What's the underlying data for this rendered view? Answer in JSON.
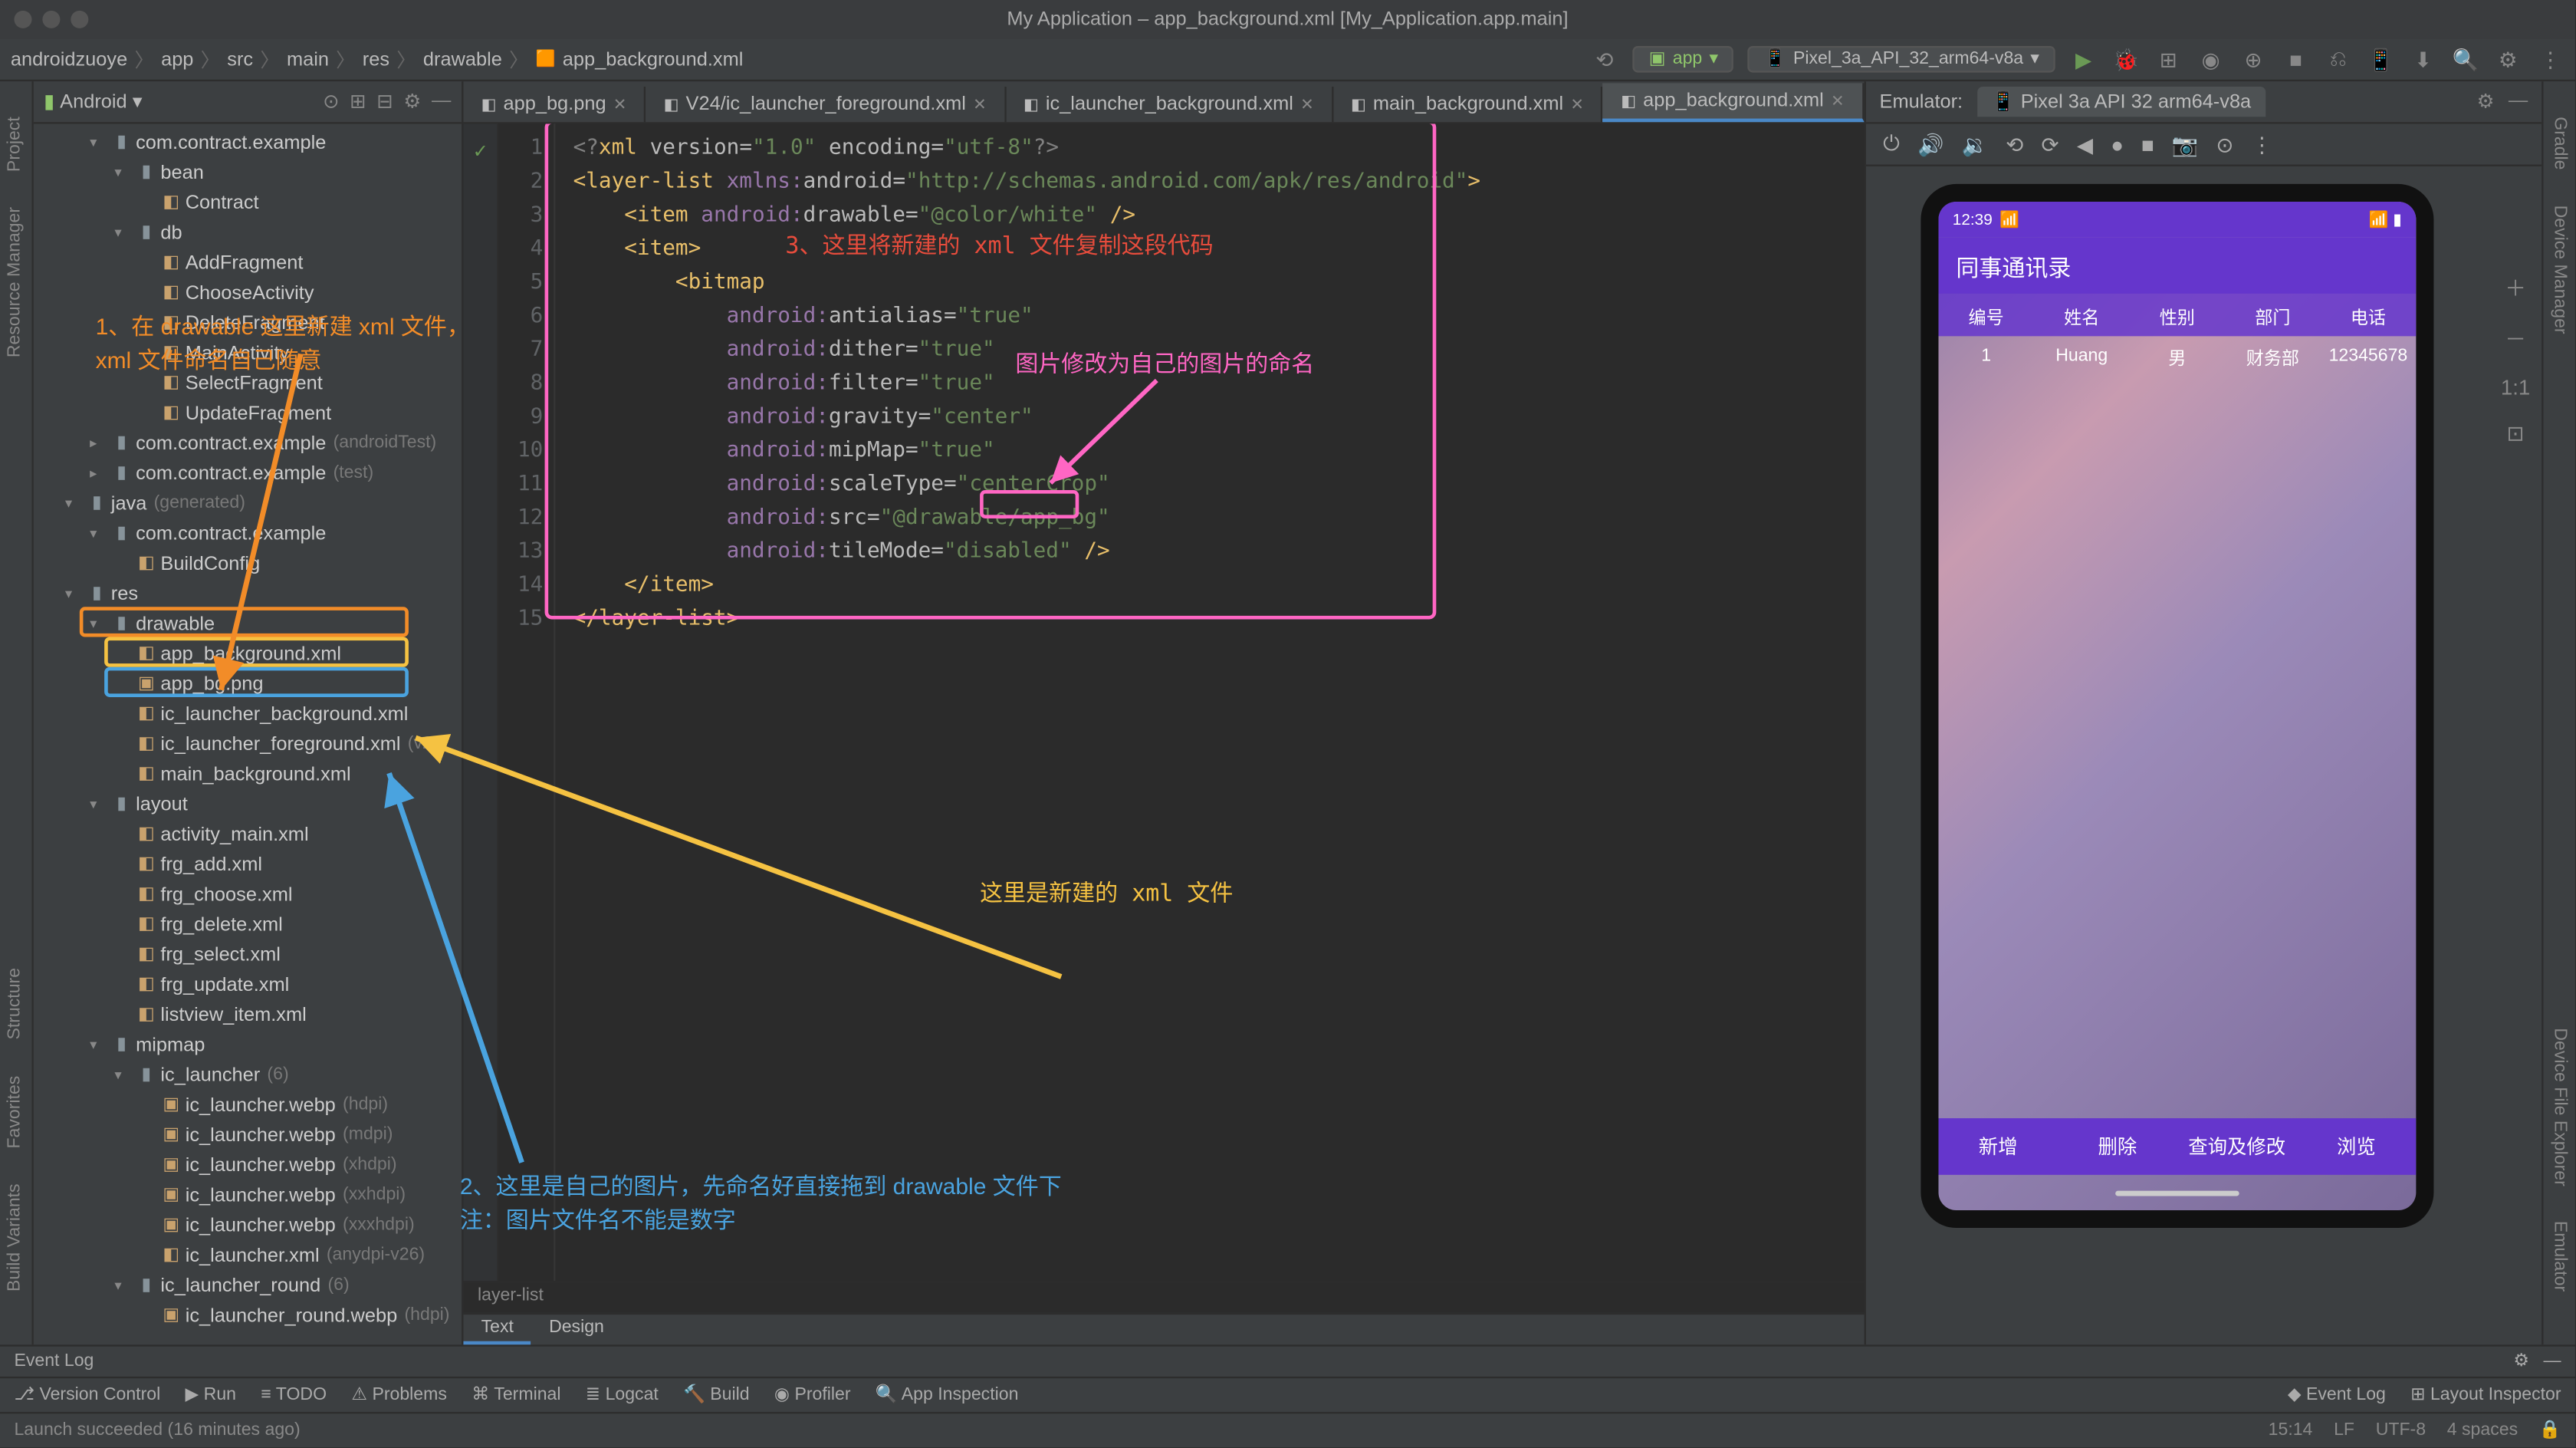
{
  "title": "My Application – app_background.xml [My_Application.app.main]",
  "breadcrumb": [
    "androidzuoye",
    "app",
    "src",
    "main",
    "res",
    "drawable",
    "app_background.xml"
  ],
  "run_config": "app",
  "device_config": "Pixel_3a_API_32_arm64-v8a",
  "project_header": "Android",
  "tree": [
    {
      "d": 2,
      "a": "v",
      "i": "folder",
      "t": "com.contract.example"
    },
    {
      "d": 3,
      "a": "v",
      "i": "folder",
      "t": "bean"
    },
    {
      "d": 4,
      "a": "",
      "i": "file",
      "t": "Contract"
    },
    {
      "d": 3,
      "a": "v",
      "i": "folder",
      "t": "db"
    },
    {
      "d": 4,
      "a": "",
      "i": "file",
      "t": "AddFragment"
    },
    {
      "d": 4,
      "a": "",
      "i": "file",
      "t": "ChooseActivity"
    },
    {
      "d": 4,
      "a": "",
      "i": "file",
      "t": "DeleteFragment"
    },
    {
      "d": 4,
      "a": "",
      "i": "file",
      "t": "MainActivity"
    },
    {
      "d": 4,
      "a": "",
      "i": "file",
      "t": "SelectFragment"
    },
    {
      "d": 4,
      "a": "",
      "i": "file",
      "t": "UpdateFragment"
    },
    {
      "d": 2,
      "a": ">",
      "i": "folder",
      "t": "com.contract.example",
      "s": "(androidTest)"
    },
    {
      "d": 2,
      "a": ">",
      "i": "folder",
      "t": "com.contract.example",
      "s": "(test)"
    },
    {
      "d": 1,
      "a": "v",
      "i": "folder",
      "t": "java",
      "s": "(generated)"
    },
    {
      "d": 2,
      "a": "v",
      "i": "folder",
      "t": "com.contract.example"
    },
    {
      "d": 3,
      "a": "",
      "i": "file",
      "t": "BuildConfig"
    },
    {
      "d": 1,
      "a": "v",
      "i": "folder",
      "t": "res"
    },
    {
      "d": 2,
      "a": "v",
      "i": "folder",
      "t": "drawable",
      "box": "orange"
    },
    {
      "d": 3,
      "a": "",
      "i": "xml",
      "t": "app_background.xml",
      "box": "yellow"
    },
    {
      "d": 3,
      "a": "",
      "i": "img",
      "t": "app_bg.png",
      "box": "blue"
    },
    {
      "d": 3,
      "a": "",
      "i": "xml",
      "t": "ic_launcher_background.xml"
    },
    {
      "d": 3,
      "a": "",
      "i": "xml",
      "t": "ic_launcher_foreground.xml",
      "s": "(v24)"
    },
    {
      "d": 3,
      "a": "",
      "i": "xml",
      "t": "main_background.xml"
    },
    {
      "d": 2,
      "a": "v",
      "i": "folder",
      "t": "layout"
    },
    {
      "d": 3,
      "a": "",
      "i": "xml",
      "t": "activity_main.xml"
    },
    {
      "d": 3,
      "a": "",
      "i": "xml",
      "t": "frg_add.xml"
    },
    {
      "d": 3,
      "a": "",
      "i": "xml",
      "t": "frg_choose.xml"
    },
    {
      "d": 3,
      "a": "",
      "i": "xml",
      "t": "frg_delete.xml"
    },
    {
      "d": 3,
      "a": "",
      "i": "xml",
      "t": "frg_select.xml"
    },
    {
      "d": 3,
      "a": "",
      "i": "xml",
      "t": "frg_update.xml"
    },
    {
      "d": 3,
      "a": "",
      "i": "xml",
      "t": "listview_item.xml"
    },
    {
      "d": 2,
      "a": "v",
      "i": "folder",
      "t": "mipmap"
    },
    {
      "d": 3,
      "a": "v",
      "i": "folder",
      "t": "ic_launcher",
      "s": "(6)"
    },
    {
      "d": 4,
      "a": "",
      "i": "img",
      "t": "ic_launcher.webp",
      "s": "(hdpi)"
    },
    {
      "d": 4,
      "a": "",
      "i": "img",
      "t": "ic_launcher.webp",
      "s": "(mdpi)"
    },
    {
      "d": 4,
      "a": "",
      "i": "img",
      "t": "ic_launcher.webp",
      "s": "(xhdpi)"
    },
    {
      "d": 4,
      "a": "",
      "i": "img",
      "t": "ic_launcher.webp",
      "s": "(xxhdpi)"
    },
    {
      "d": 4,
      "a": "",
      "i": "img",
      "t": "ic_launcher.webp",
      "s": "(xxxhdpi)"
    },
    {
      "d": 4,
      "a": "",
      "i": "xml",
      "t": "ic_launcher.xml",
      "s": "(anydpi-v26)"
    },
    {
      "d": 3,
      "a": "v",
      "i": "folder",
      "t": "ic_launcher_round",
      "s": "(6)"
    },
    {
      "d": 4,
      "a": "",
      "i": "img",
      "t": "ic_launcher_round.webp",
      "s": "(hdpi)"
    }
  ],
  "tabs": [
    {
      "label": "app_bg.png",
      "icon": "img"
    },
    {
      "label": "V24/ic_launcher_foreground.xml",
      "icon": "xml"
    },
    {
      "label": "ic_launcher_background.xml",
      "icon": "xml"
    },
    {
      "label": "main_background.xml",
      "icon": "xml"
    },
    {
      "label": "app_background.xml",
      "icon": "xml",
      "active": true
    }
  ],
  "code_breadcrumb": "layer-list",
  "bottom_tabs": [
    "Text",
    "Design"
  ],
  "code_lines": 15,
  "emulator": {
    "title": "Emulator:",
    "device": "Pixel 3a API 32 arm64-v8a",
    "status_time": "12:39",
    "app_title": "同事通讯录",
    "table_headers": [
      "编号",
      "姓名",
      "性别",
      "部门",
      "电话"
    ],
    "table_row": [
      "1",
      "Huang",
      "男",
      "财务部",
      "12345678"
    ],
    "bottom_buttons": [
      "新增",
      "删除",
      "查询及修改",
      "浏览"
    ]
  },
  "annotations": {
    "a1": "1、在 drawable 这里新建 xml 文件，\nxml 文件命名自己随意",
    "a2": "3、这里将新建的 xml 文件复制这段代码",
    "a3": "图片修改为自己的图片的命名",
    "a4": "这里是新建的 xml 文件",
    "a5": "2、这里是自己的图片，先命名好直接拖到 drawable 文件下\n注：图片文件名不能是数字"
  },
  "eventlog": "Event Log",
  "toolstrip": {
    "version": "Version Control",
    "run": "Run",
    "todo": "TODO",
    "problems": "Problems",
    "terminal": "Terminal",
    "logcat": "Logcat",
    "build": "Build",
    "profiler": "Profiler",
    "appinsp": "App Inspection",
    "eventlog": "Event Log",
    "layoutinsp": "Layout Inspector"
  },
  "statusbar": {
    "msg": "Launch succeeded (16 minutes ago)",
    "pos": "15:14",
    "lf": "LF",
    "enc": "UTF-8",
    "spaces": "4 spaces"
  },
  "left_gutter": [
    "Project",
    "Resource Manager"
  ],
  "left_gutter2": [
    "Structure",
    "Favorites",
    "Build Variants"
  ],
  "right_gutter": [
    "Gradle",
    "Device Manager"
  ],
  "right_gutter2": [
    "Device File Explorer",
    "Emulator"
  ]
}
